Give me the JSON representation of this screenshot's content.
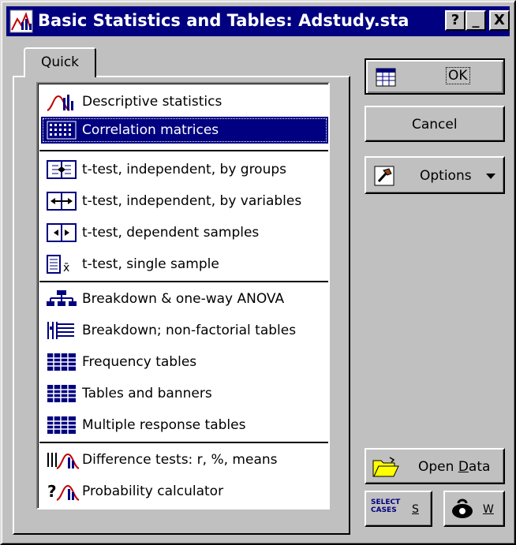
{
  "window": {
    "title": "Basic Statistics and Tables: Adstudy.sta"
  },
  "titlebar_buttons": {
    "help": "?",
    "minimize": "_",
    "close": "X"
  },
  "tab": {
    "label": "Quick"
  },
  "list": {
    "selected_index": 1,
    "items": [
      {
        "label": "Descriptive statistics",
        "icon": "histogram-icon"
      },
      {
        "label": "Correlation matrices",
        "icon": "matrix-icon"
      },
      {
        "label": "t-test, independent, by groups",
        "icon": "t-test-groups-icon"
      },
      {
        "label": "t-test, independent, by variables",
        "icon": "t-test-variables-icon"
      },
      {
        "label": "t-test, dependent samples",
        "icon": "t-test-dependent-icon"
      },
      {
        "label": "t-test, single sample",
        "icon": "t-test-single-icon"
      },
      {
        "label": "Breakdown & one-way ANOVA",
        "icon": "tree-icon"
      },
      {
        "label": "Breakdown; non-factorial tables",
        "icon": "breakdown-table-icon"
      },
      {
        "label": "Frequency tables",
        "icon": "grid-icon"
      },
      {
        "label": "Tables and banners",
        "icon": "grid-icon"
      },
      {
        "label": "Multiple response tables",
        "icon": "grid-icon"
      },
      {
        "label": "Difference tests: r, %, means",
        "icon": "difference-icon"
      },
      {
        "label": "Probability calculator",
        "icon": "probability-icon"
      }
    ]
  },
  "buttons": {
    "ok": "OK",
    "cancel": "Cancel",
    "options": "Options",
    "open_data_prefix": "Open ",
    "open_data_underlined": "D",
    "open_data_suffix": "ata",
    "select_cases_icon_text_1": "SELECT",
    "select_cases_icon_text_2": "CASES",
    "select_cases_key": "S",
    "weight_key": "W"
  },
  "colors": {
    "selection": "#000080",
    "face": "#c0c0c0",
    "accent_red": "#cc0000"
  }
}
